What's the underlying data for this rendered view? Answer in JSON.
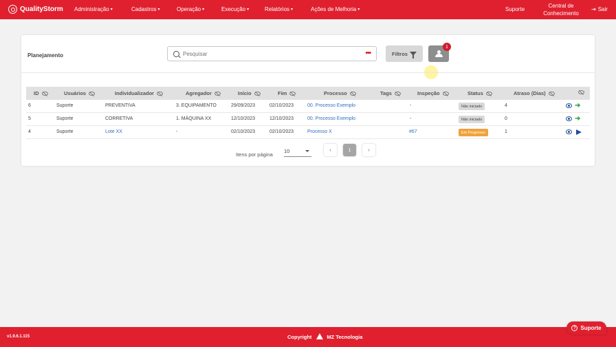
{
  "app": {
    "logo_text": "QualityStorm"
  },
  "nav": {
    "items": [
      "Administração",
      "Cadastros",
      "Operação",
      "Execução",
      "Relatórios",
      "Ações de Melhoria"
    ],
    "support": "Suporte",
    "knowledge_line1": "Central de",
    "knowledge_line2": "Conhecimento",
    "logout": "Sair"
  },
  "panel": {
    "title": "Planejamento",
    "search_placeholder": "Pesquisar",
    "filter_label": "Filtros",
    "user_badge": "1"
  },
  "table": {
    "headers": [
      "ID",
      "Usuários",
      "Individualizador",
      "Agregador",
      "Início",
      "Fim",
      "Processo",
      "Tags",
      "Inspeção",
      "Status",
      "Atraso (Dias)"
    ],
    "rows": [
      {
        "id": "6",
        "usuario": "Suporte",
        "individualizador": "PREVENTIVA",
        "agregador": "3. EQUIPAMENTO",
        "inicio": "29/09/2023",
        "fim": "02/10/2023",
        "processo": "00. Processo Exemplo",
        "tags": "",
        "inspecao": "-",
        "status": "Não iniciado",
        "atraso": "4"
      },
      {
        "id": "5",
        "usuario": "Suporte",
        "individualizador": "CORRETIVA",
        "agregador": "1. MÁQUINA XX",
        "inicio": "12/10/2023",
        "fim": "12/10/2023",
        "processo": "00. Processo Exemplo",
        "tags": "",
        "inspecao": "-",
        "status": "Não iniciado",
        "atraso": "0"
      },
      {
        "id": "4",
        "usuario": "Suporte",
        "individualizador": "Lote XX",
        "agregador": "-",
        "inicio": "02/10/2023",
        "fim": "02/10/2023",
        "processo": "Processo X",
        "tags": "",
        "inspecao": "#67",
        "status": "Em Progresso",
        "atraso": "1"
      }
    ]
  },
  "pagination": {
    "per_page_label": "Itens por página",
    "per_page_value": "10",
    "prev": "‹",
    "current_page": "1",
    "next": "›"
  },
  "footer": {
    "version": "v1.9.6.1.115",
    "copyright": "Copyright",
    "company": "MZ Tecnologia",
    "support_button": "Suporte"
  },
  "colors": {
    "brand": "#e0202f",
    "link": "#2f6fc0",
    "status_in_progress": "#f0a23c",
    "status_not_started": "#d9d9d9"
  }
}
